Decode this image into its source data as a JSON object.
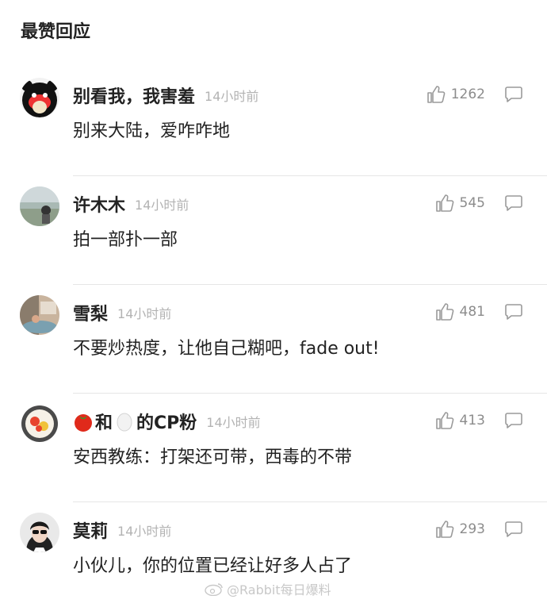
{
  "section": {
    "title": "最赞回应"
  },
  "comments": [
    {
      "username": "别看我，我害羞",
      "time": "14小时前",
      "text": "别来大陆，爱咋咋地",
      "likes": "1262",
      "avatar": "bear-avatar"
    },
    {
      "username": "许木木",
      "time": "14小时前",
      "text": "拍一部扑一部",
      "likes": "545",
      "avatar": "lake-photo-avatar"
    },
    {
      "username": "雪梨",
      "time": "14小时前",
      "text": "不要炒热度，让他自己糊吧，fade out!",
      "likes": "481",
      "avatar": "room-photo-avatar"
    },
    {
      "username_suffix": "的CP粉",
      "username_joiner": "和",
      "time": "14小时前",
      "text": "安西教练：打架还可带，西毒的不带",
      "likes": "413",
      "avatar": "tomato-egg-avatar",
      "emoji": [
        "tomato-emoji",
        "egg-emoji"
      ]
    },
    {
      "username": "莫莉",
      "time": "14小时前",
      "text": "小伙儿，你的位置已经让好多人占了",
      "likes": "293",
      "avatar": "sunglasses-woman-avatar"
    }
  ],
  "watermark": {
    "text": "@Rabbit每日爆料"
  },
  "colors": {
    "text": "#222222",
    "muted": "#b3b3b3",
    "icon": "#9a9a9a",
    "divider": "#e6e6e6"
  }
}
